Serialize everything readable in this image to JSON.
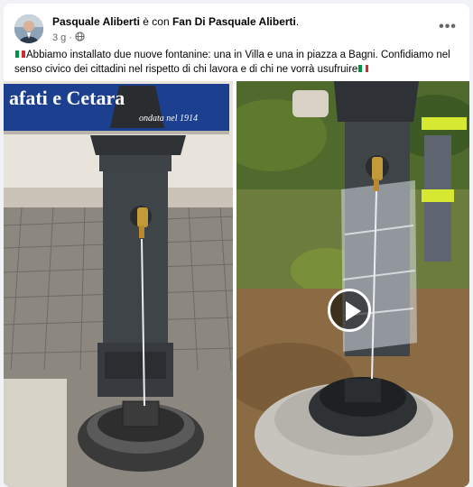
{
  "post": {
    "author": "Pasquale Aliberti",
    "with_text": " è con ",
    "page": "Fan Di Pasquale Aliberti",
    "page_suffix": ".",
    "time": "3 g",
    "separator": "·",
    "privacy_icon": "globe-icon",
    "more_icon": "more-icon",
    "more_label": "•••",
    "text_part1": "Abbiamo installato due nuove fontanine: una in Villa e una in piazza a Bagni. Confidiamo nel senso civico dei cittadini nel rispetto di chi lavora e di chi ne vorrà usufruire",
    "flag_colors": [
      "#009246",
      "#ffffff",
      "#ce2b37"
    ]
  },
  "photos": {
    "left_sign_line1": "afati e Cetara",
    "left_sign_line2": "ondata nel 1914",
    "right_play_icon": "play-icon"
  },
  "colors": {
    "link": "#050505",
    "secondary": "#65676b",
    "sign_blue": "#1d3f8f"
  }
}
